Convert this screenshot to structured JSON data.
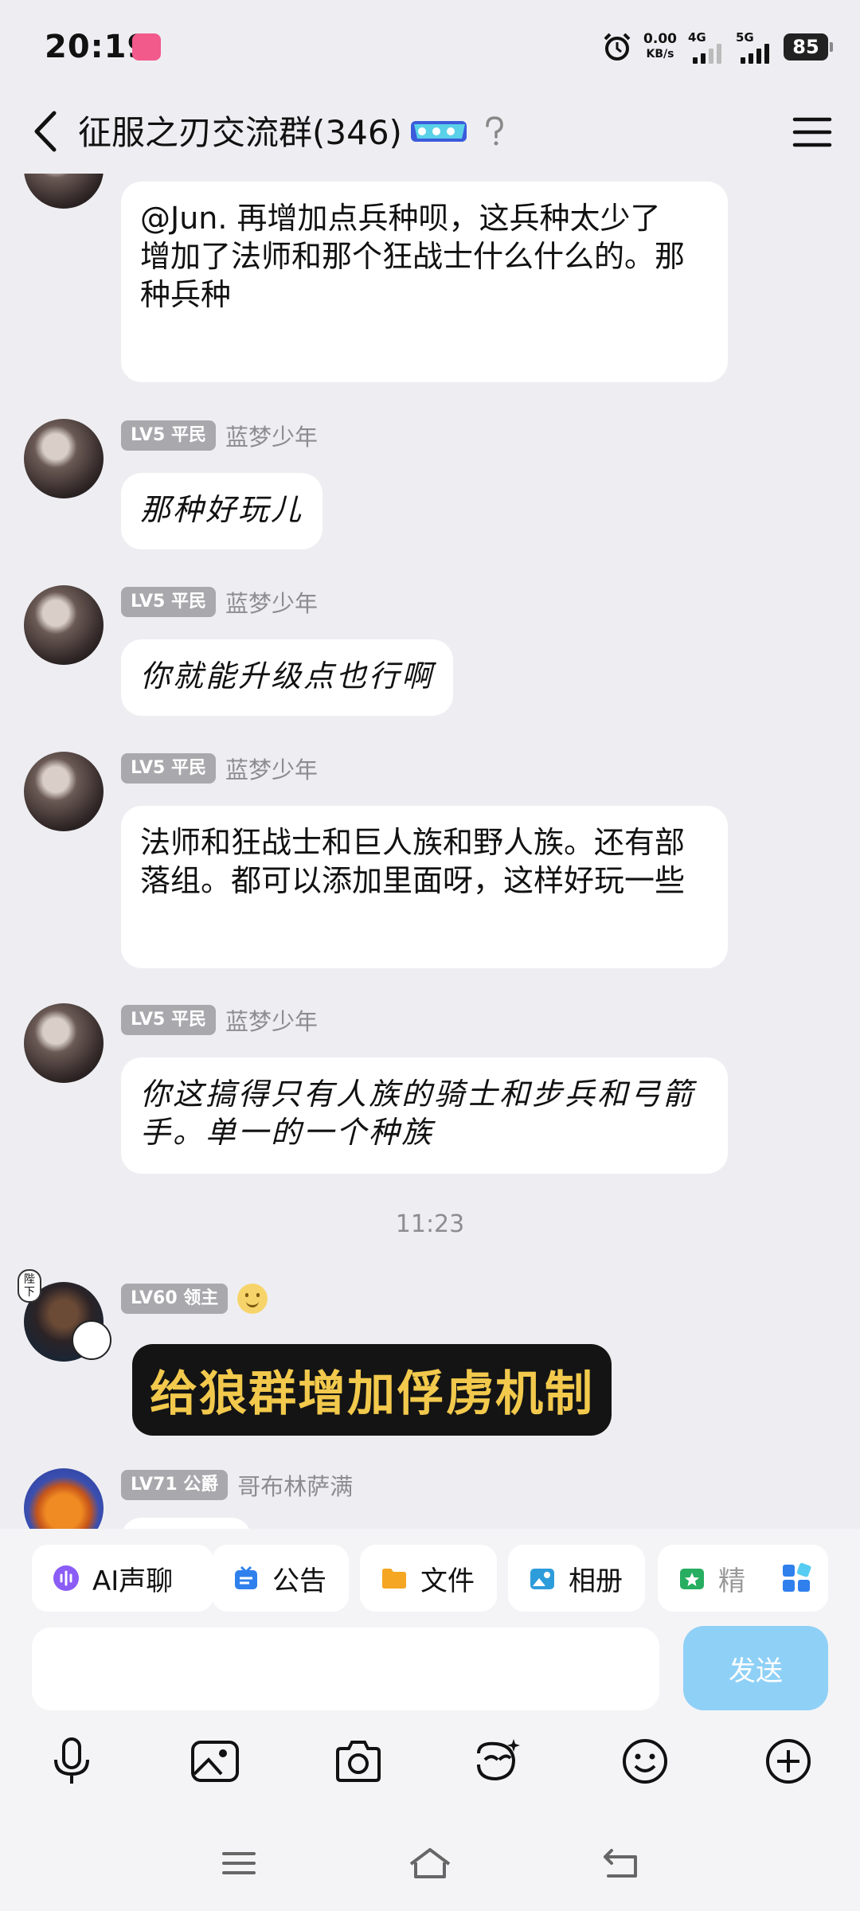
{
  "status_bar": {
    "time": "20:19",
    "net_speed_value": "0.00",
    "net_speed_unit": "KB/s",
    "sim1_label": "4G",
    "sim2_label": "5G",
    "battery": "85"
  },
  "header": {
    "title": "征服之刃交流群(346)"
  },
  "messages": [
    {
      "sender": {
        "level": "",
        "name": ""
      },
      "text": "@Jun. 再增加点兵种呗，这兵种太少了\n增加了法师和那个狂战士什么什么的。那种兵种"
    },
    {
      "sender": {
        "level": "LV5 平民",
        "name": "蓝梦少年"
      },
      "text": "那种好玩儿"
    },
    {
      "sender": {
        "level": "LV5 平民",
        "name": "蓝梦少年"
      },
      "text": "你就能升级点也行啊"
    },
    {
      "sender": {
        "level": "LV5 平民",
        "name": "蓝梦少年"
      },
      "text": "法师和狂战士和巨人族和野人族。还有部落组。都可以添加里面呀，这样好玩一些"
    },
    {
      "sender": {
        "level": "LV5 平民",
        "name": "蓝梦少年"
      },
      "text": "你这搞得只有人族的骑士和步兵和弓箭手。单一的一个种族"
    }
  ],
  "timestamp": "11:23",
  "admin_message": {
    "level": "LV60 领主",
    "guard_badge": "陛下",
    "text": "给狼群增加俘虏机制"
  },
  "last_message": {
    "level": "LV71 公爵",
    "name": "哥布林萨满"
  },
  "quick_actions": [
    {
      "label": "AI声聊",
      "icon": "ai-voice-icon",
      "color": "#8b5cf6"
    },
    {
      "label": "公告",
      "icon": "announcement-icon",
      "color": "#2f80ed"
    },
    {
      "label": "文件",
      "icon": "folder-icon",
      "color": "#f5a623"
    },
    {
      "label": "相册",
      "icon": "album-icon",
      "color": "#2d9cdb"
    },
    {
      "label": "精",
      "icon": "featured-icon",
      "color": "#27ae60"
    }
  ],
  "input": {
    "placeholder": "",
    "send_label": "发送"
  },
  "toolbar_icons": [
    "microphone-icon",
    "image-icon",
    "camera-icon",
    "sticker-icon",
    "emoji-icon",
    "plus-icon"
  ],
  "nav_icons": [
    "recents-icon",
    "home-icon",
    "back-icon"
  ],
  "colors": {
    "background": "#eeeef2",
    "send_button": "#8fd0f7",
    "level_badge": "#a9a9ad",
    "sticker_text": "#f2c94c"
  }
}
